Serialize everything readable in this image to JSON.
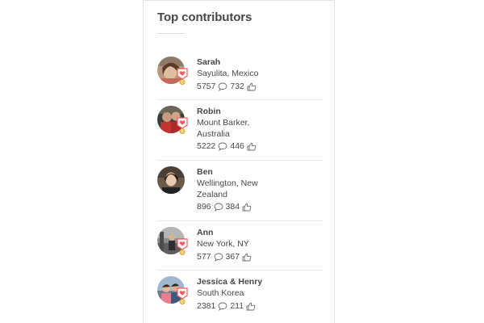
{
  "widget": {
    "title": "Top contributors"
  },
  "contributors": [
    {
      "name": "Sarah",
      "location_lines": [
        "Sayulita, Mexico"
      ],
      "reviews": "5757",
      "likes": "732",
      "has_badge": true
    },
    {
      "name": "Robin",
      "location_lines": [
        "Mount Barker,",
        "Australia"
      ],
      "reviews": "5222",
      "likes": "446",
      "has_badge": true
    },
    {
      "name": "Ben",
      "location_lines": [
        "Wellington, New",
        "Zealand"
      ],
      "reviews": "896",
      "likes": "384",
      "has_badge": false
    },
    {
      "name": "Ann",
      "location_lines": [
        "New York, NY"
      ],
      "reviews": "577",
      "likes": "367",
      "has_badge": true
    },
    {
      "name": "Jessica & Henry",
      "location_lines": [
        "South Korea"
      ],
      "reviews": "2381",
      "likes": "211",
      "has_badge": true
    }
  ],
  "icons": {
    "reviews": "speech-bubble-icon",
    "likes": "thumbs-up-icon",
    "badge": "heart-medal-badge-icon"
  },
  "colors": {
    "text": "#484848",
    "divider": "#e6e6e6",
    "badge_red": "#ff5a5f",
    "badge_gold": "#d4a63c"
  }
}
